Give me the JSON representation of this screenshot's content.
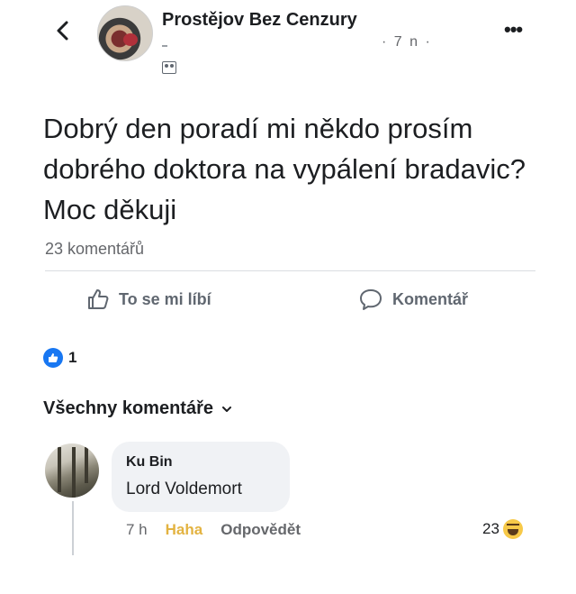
{
  "header": {
    "page_name": "Prostějov Bez Cenzury",
    "post_meta": "· 7 n ·",
    "more_icon": "•••"
  },
  "post": {
    "text": "Dobrý den poradí mi někdo prosím dobrého doktora na vypálení bradavic?Moc děkuji",
    "comment_count": "23 komentářů"
  },
  "actions": {
    "like_label": "To se mi líbí",
    "comment_label": "Komentář"
  },
  "reactions": {
    "count": "1"
  },
  "comments_section": {
    "filter_label": "Všechny komentáře",
    "comments": [
      {
        "author": "Ku Bin",
        "text": "Lord Voldemort",
        "time": "7 h",
        "reaction_label": "Haha",
        "reply_label": "Odpovědět",
        "reaction_count": "23"
      }
    ]
  },
  "colors": {
    "like_blue": "#1877f2",
    "text_primary": "#1c1e21",
    "text_secondary": "#65676b",
    "haha_yellow": "#e3b341",
    "bubble_bg": "#f0f2f5"
  },
  "icons": {
    "back": "chevron-left-icon",
    "more": "more-horizontal-icon",
    "group": "group-members-icon",
    "like": "thumbs-up-icon",
    "comment": "comment-bubble-icon",
    "like_reaction": "like-reaction-icon",
    "dropdown": "chevron-down-icon",
    "haha": "haha-reaction-icon"
  }
}
